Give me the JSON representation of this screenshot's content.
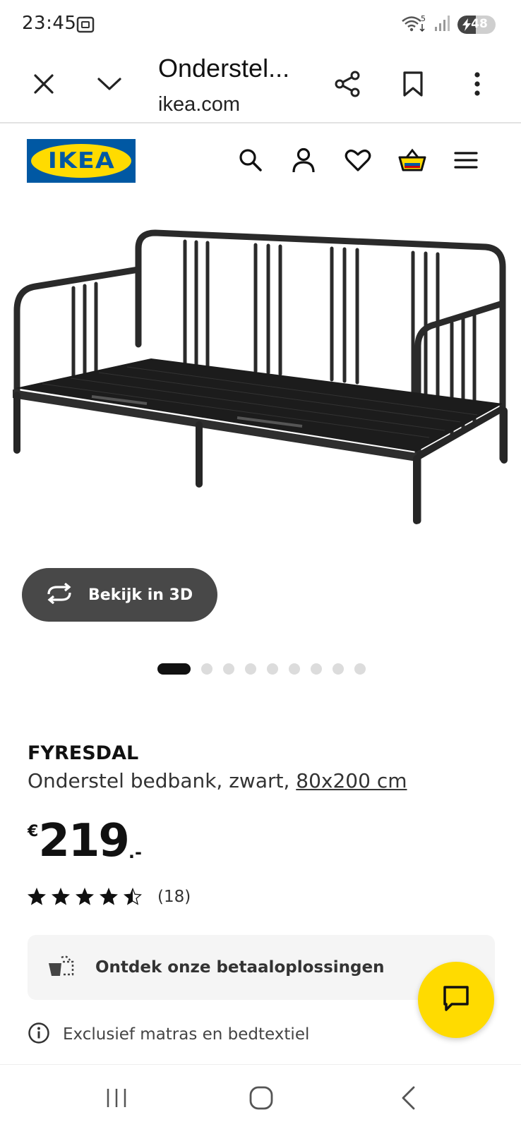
{
  "status_bar": {
    "time": "23:45",
    "battery_level": "48",
    "wifi_badge": "5",
    "icons": [
      "screenshot-icon",
      "wifi-icon",
      "signal-icon",
      "battery-icon"
    ]
  },
  "browser": {
    "title": "Onderstel...",
    "domain": "ikea.com",
    "icons": [
      "close-icon",
      "chevron-down-icon",
      "share-icon",
      "bookmark-icon",
      "more-vert-icon"
    ]
  },
  "site_header": {
    "logo_text": "IKEA",
    "icons": [
      "search-icon",
      "user-icon",
      "heart-icon",
      "cart-icon",
      "menu-icon"
    ]
  },
  "gallery": {
    "view_3d_label": "Bekijk in 3D",
    "total_images": 9,
    "active_index": 0
  },
  "product": {
    "name": "FYRESDAL",
    "description": "Onderstel bedbank, zwart,",
    "size": "80x200 cm",
    "price_currency": "€",
    "price_integer": "219",
    "price_decimal": ".-",
    "rating_value": 4.5,
    "rating_count": "(18)"
  },
  "payment": {
    "label": "Ontdek onze betaaloplossingen"
  },
  "info": {
    "text": "Exclusief matras en bedtextiel"
  },
  "colors": {
    "ikea_blue": "#0058a3",
    "ikea_yellow": "#ffdb00",
    "button_dark": "#484848"
  }
}
